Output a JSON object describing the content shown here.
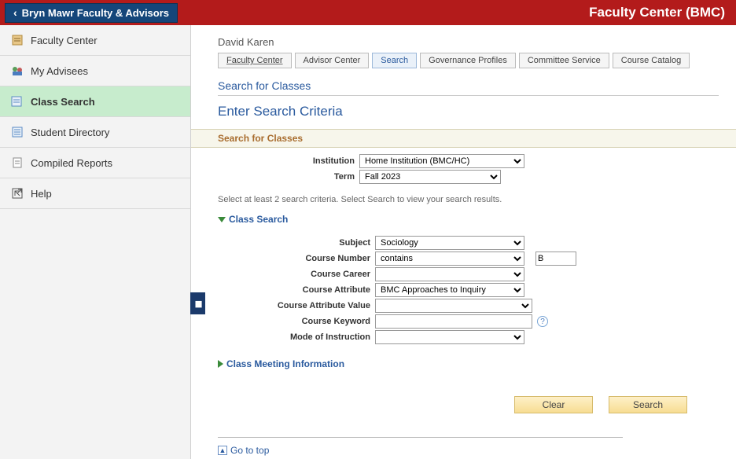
{
  "header": {
    "back_label": "Bryn Mawr Faculty & Advisors",
    "title": "Faculty Center (BMC)"
  },
  "sidebar": {
    "items": [
      {
        "label": "Faculty Center",
        "icon": "faculty-center-icon"
      },
      {
        "label": "My Advisees",
        "icon": "advisees-icon"
      },
      {
        "label": "Class Search",
        "icon": "class-search-icon"
      },
      {
        "label": "Student Directory",
        "icon": "directory-icon"
      },
      {
        "label": "Compiled Reports",
        "icon": "reports-icon"
      },
      {
        "label": "Help",
        "icon": "help-icon"
      }
    ],
    "active_index": 2
  },
  "main": {
    "user_name": "David Karen",
    "tabs": [
      {
        "label": "Faculty Center"
      },
      {
        "label": "Advisor Center"
      },
      {
        "label": "Search"
      },
      {
        "label": "Governance Profiles"
      },
      {
        "label": "Committee Service"
      },
      {
        "label": "Course Catalog"
      }
    ],
    "active_tab_index": 2,
    "heading_small": "Search for Classes",
    "heading_large": "Enter Search Criteria",
    "panel_title": "Search for Classes",
    "helper_text": "Select at least 2 search criteria. Select Search to view your search results.",
    "institution": {
      "label": "Institution",
      "value": "Home Institution (BMC/HC)"
    },
    "term": {
      "label": "Term",
      "value": "Fall 2023"
    },
    "class_search_toggle": "Class Search",
    "subject": {
      "label": "Subject",
      "value": "Sociology"
    },
    "course_number": {
      "label": "Course Number",
      "op_value": "contains",
      "text_value": "B"
    },
    "course_career": {
      "label": "Course Career",
      "value": ""
    },
    "course_attribute": {
      "label": "Course Attribute",
      "value": "BMC Approaches to Inquiry"
    },
    "course_attribute_value": {
      "label": "Course Attribute Value",
      "value": ""
    },
    "course_keyword": {
      "label": "Course Keyword",
      "value": ""
    },
    "mode_of_instruction": {
      "label": "Mode of Instruction",
      "value": ""
    },
    "meeting_toggle": "Class Meeting Information",
    "buttons": {
      "clear": "Clear",
      "search": "Search"
    },
    "go_to_top": "Go to top"
  }
}
